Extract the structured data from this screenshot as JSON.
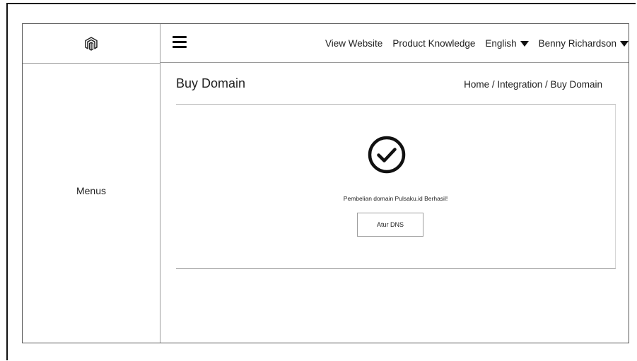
{
  "header": {
    "nav": [
      "View Website",
      "Product Knowledge"
    ],
    "language": "English",
    "user": "Benny Richardson"
  },
  "sidebar": {
    "menus_label": "Menus"
  },
  "page": {
    "title": "Buy Domain",
    "breadcrumb": "Home / Integration / Buy Domain"
  },
  "panel": {
    "message": "Pembelian domain Pulsaku.id Berhasil!",
    "button_label": "Atur DNS"
  },
  "icons": {
    "logo": "magento-logo-icon",
    "menu": "hamburger-menu-icon",
    "success": "check-circle-icon",
    "dropdown": "caret-down-icon"
  }
}
